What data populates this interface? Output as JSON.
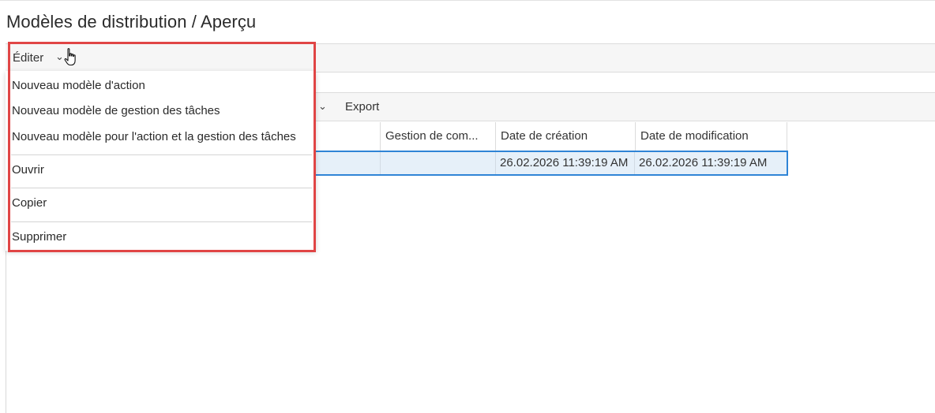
{
  "header": {
    "title": "Modèles de distribution / Aperçu"
  },
  "menubar": {
    "edit_label": "Éditer",
    "caret": "⌄"
  },
  "toolbar": {
    "caret": "⌄",
    "export_label": "Export"
  },
  "grid": {
    "columns": [
      "",
      "Gestion de com...",
      "Date de création",
      "Date de modification"
    ],
    "rows": [
      [
        "",
        "",
        "26.02.2026 11:39:19 AM",
        "26.02.2026 11:39:19 AM"
      ]
    ]
  },
  "edit_menu": {
    "items": [
      "Nouveau modèle d'action",
      "Nouveau modèle de gestion des tâches",
      "Nouveau modèle pour l'action et la gestion des tâches",
      "Ouvrir",
      "Copier",
      "Supprimer"
    ]
  },
  "colors": {
    "highlight": "#e04545",
    "selection_border": "#2f84d6",
    "selection_fill": "#e6f0f9"
  },
  "icons": {
    "cursor": "hand-pointer-icon"
  }
}
